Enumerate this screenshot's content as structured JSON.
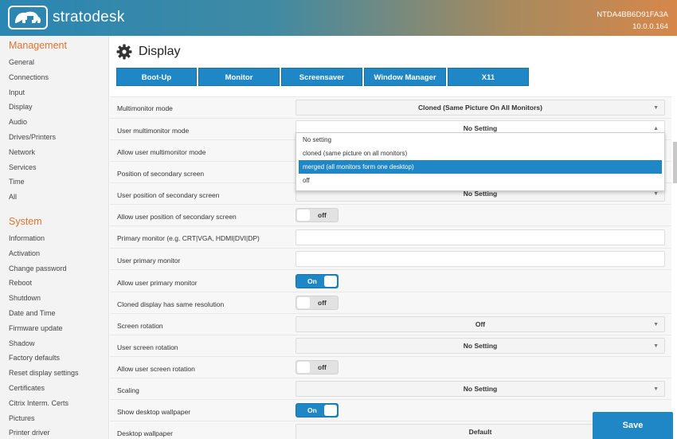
{
  "header": {
    "brand": "stratodesk",
    "device_id": "NTDA4BB6D91FA3A",
    "ip": "10.0.0.164"
  },
  "sidebar": {
    "management_title": "Management",
    "management_items": [
      "General",
      "Connections",
      "Input",
      "Display",
      "Audio",
      "Drives/Printers",
      "Network",
      "Services",
      "Time",
      "All"
    ],
    "system_title": "System",
    "system_items": [
      "Information",
      "Activation",
      "Change password",
      "Reboot",
      "Shutdown",
      "Date and Time",
      "Firmware update",
      "Shadow",
      "Factory defaults",
      "Reset display settings",
      "Certificates",
      "Citrix Interm. Certs",
      "Pictures",
      "Printer driver"
    ]
  },
  "page": {
    "title": "Display",
    "icon": "gear-icon"
  },
  "tabs": [
    "Boot-Up",
    "Monitor",
    "Screensaver",
    "Window Manager",
    "X11"
  ],
  "form": {
    "multimonitor_mode": {
      "label": "Multimonitor mode",
      "value": "Cloned (Same Picture On All Monitors)"
    },
    "user_multimonitor_mode": {
      "label": "User multimonitor mode",
      "value": "No Setting"
    },
    "allow_user_multimonitor_mode": {
      "label": "Allow user multimonitor mode"
    },
    "position_secondary_screen": {
      "label": "Position of secondary screen"
    },
    "user_position_secondary_screen": {
      "label": "User position of secondary screen",
      "value": "No Setting"
    },
    "allow_user_position_secondary": {
      "label": "Allow user position of secondary screen",
      "value": "off"
    },
    "primary_monitor": {
      "label": "Primary monitor (e.g. CRT|VGA, HDMI|DVI|DP)",
      "value": ""
    },
    "user_primary_monitor": {
      "label": "User primary monitor",
      "value": ""
    },
    "allow_user_primary_monitor": {
      "label": "Allow user primary monitor",
      "value": "On"
    },
    "cloned_same_resolution": {
      "label": "Cloned display has same resolution",
      "value": "off"
    },
    "screen_rotation": {
      "label": "Screen rotation",
      "value": "Off"
    },
    "user_screen_rotation": {
      "label": "User screen rotation",
      "value": "No Setting"
    },
    "allow_user_screen_rotation": {
      "label": "Allow user screen rotation",
      "value": "off"
    },
    "scaling": {
      "label": "Scaling",
      "value": "No Setting"
    },
    "show_desktop_wallpaper": {
      "label": "Show desktop wallpaper",
      "value": "On"
    },
    "desktop_wallpaper": {
      "label": "Desktop wallpaper",
      "value": "Default"
    }
  },
  "dropdown": {
    "options": [
      "No setting",
      "cloned (same picture on all monitors)",
      "merged (all monitors form one desktop)",
      "off"
    ],
    "highlighted_index": 2
  },
  "save_label": "Save",
  "colors": {
    "accent": "#1f87c5",
    "section_title": "#e07332"
  }
}
